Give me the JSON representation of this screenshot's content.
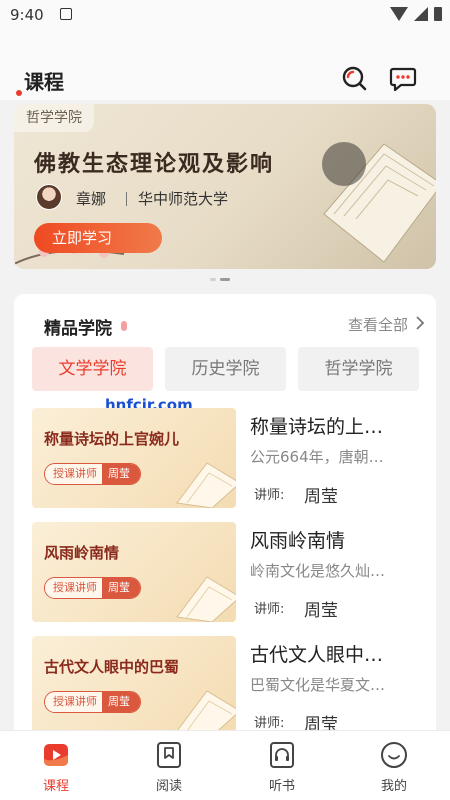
{
  "status_bar": {
    "time": "9:40"
  },
  "header": {
    "title": "课程"
  },
  "banner": {
    "tag": "哲学学院",
    "title": "佛教生态理论观及影响",
    "author": "章娜",
    "school": "华中师范大学",
    "button": "立即学习"
  },
  "section": {
    "title": "精品学院",
    "view_all": "查看全部",
    "tabs": [
      {
        "label": "文学学院",
        "active": true
      },
      {
        "label": "历史学院",
        "active": false
      },
      {
        "label": "哲学学院",
        "active": false
      }
    ]
  },
  "watermark": "hnfcjr.com",
  "courses": [
    {
      "thumb_title": "称量诗坛的上官婉儿",
      "tag_label": "授课讲师",
      "tag_name": "周莹",
      "title": "称量诗坛的上…",
      "desc": "公元664年，唐朝…",
      "tutor_label": "讲师:",
      "tutor": "周莹"
    },
    {
      "thumb_title": "风雨岭南情",
      "tag_label": "授课讲师",
      "tag_name": "周莹",
      "title": "风雨岭南情",
      "desc": "岭南文化是悠久灿…",
      "tutor_label": "讲师:",
      "tutor": "周莹"
    },
    {
      "thumb_title": "古代文人眼中的巴蜀",
      "tag_label": "授课讲师",
      "tag_name": "周莹",
      "title": "古代文人眼中…",
      "desc": "巴蜀文化是华夏文…",
      "tutor_label": "讲师:",
      "tutor": "周莹"
    }
  ],
  "tabbar": {
    "items": [
      {
        "label": "课程",
        "icon": "play-icon",
        "active": true
      },
      {
        "label": "阅读",
        "icon": "bookmark-icon",
        "active": false
      },
      {
        "label": "听书",
        "icon": "headphones-icon",
        "active": false
      },
      {
        "label": "我的",
        "icon": "smile-icon",
        "active": false
      }
    ]
  },
  "colors": {
    "accent": "#ea3c2c",
    "tab_active_bg": "#fbe4e0"
  }
}
